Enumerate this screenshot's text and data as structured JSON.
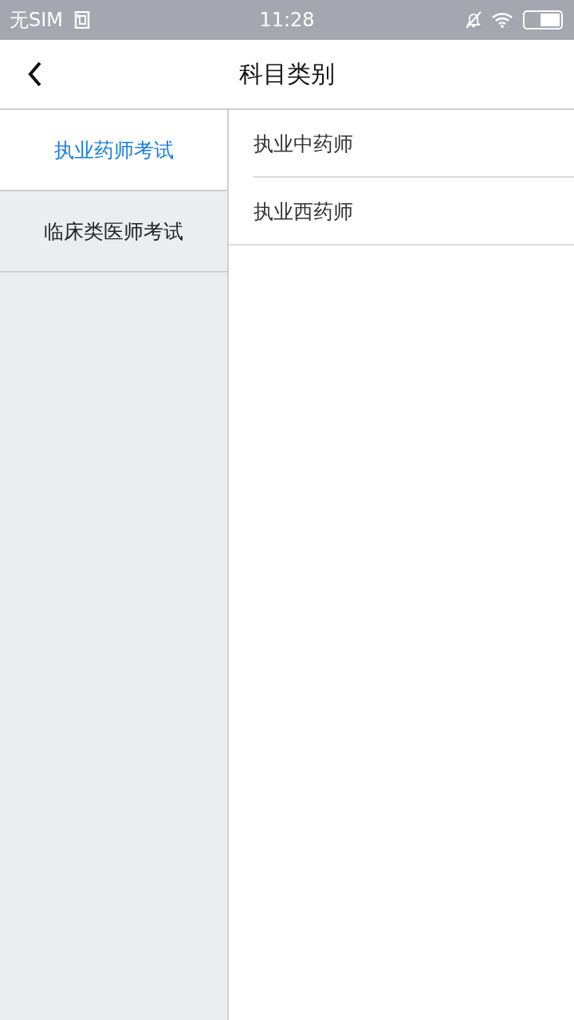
{
  "status_bar": {
    "carrier": "无SIM",
    "time": "11:28"
  },
  "header": {
    "title": "科目类别"
  },
  "categories": [
    {
      "label": "执业药师考试",
      "selected": true
    },
    {
      "label": "临床类医师考试",
      "selected": false
    }
  ],
  "subjects": [
    {
      "label": "执业中药师"
    },
    {
      "label": "执业西药师"
    }
  ]
}
